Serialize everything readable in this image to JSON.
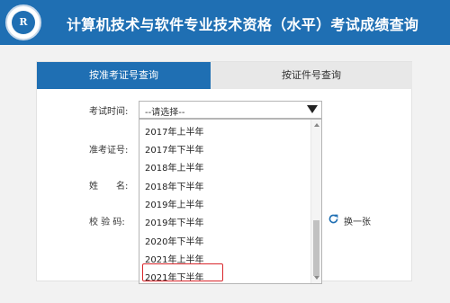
{
  "header": {
    "title": "计算机技术与软件专业技术资格（水平）考试成绩查询",
    "logo_icon": "exam-seal-logo"
  },
  "colors": {
    "primary": "#1f6fb3",
    "highlight": "#d9262b"
  },
  "tabs": [
    {
      "label": "按准考证号查询",
      "active": true
    },
    {
      "label": "按证件号查询",
      "active": false
    }
  ],
  "form": {
    "exam_time_label": "考试时间:",
    "admission_no_label": "准考证号:",
    "name_label": "姓　　名:",
    "captcha_label": "校 验 码:",
    "select": {
      "value": "--请选择--",
      "arrow_icon": "triangle-down-icon"
    },
    "options": [
      "2017年上半年",
      "2017年下半年",
      "2018年上半年",
      "2018年下半年",
      "2019年上半年",
      "2019年下半年",
      "2020年下半年",
      "2021年上半年",
      "2021年下半年"
    ],
    "highlighted_option": "2021年下半年",
    "refresh_label": "换一张",
    "refresh_icon": "refresh-icon"
  }
}
